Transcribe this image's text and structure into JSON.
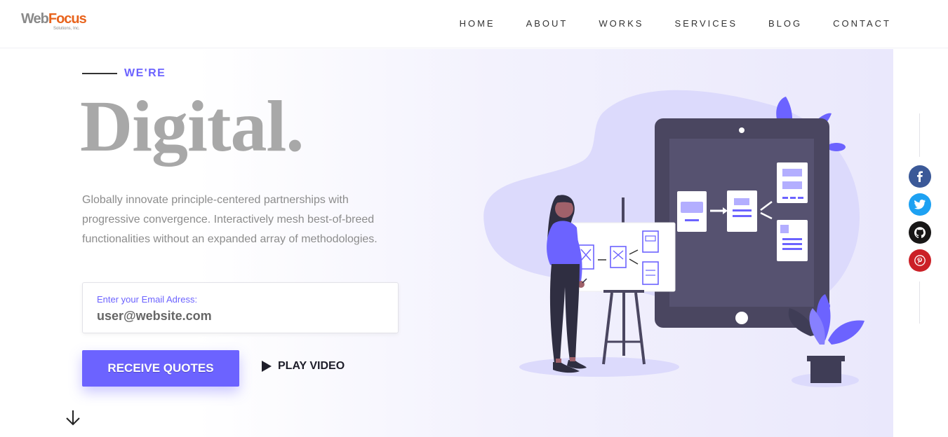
{
  "header": {
    "logo": {
      "part1": "Web",
      "part2": "Focus",
      "sub": "Solutions, Inc."
    },
    "nav": [
      "HOME",
      "ABOUT",
      "WORKS",
      "SERVICES",
      "BLOG",
      "CONTACT"
    ]
  },
  "hero": {
    "kicker": "WE'RE",
    "headline": "Digital.",
    "paragraph": "Globally innovate principle-centered partnerships with progressive convergence. Interactively mesh best-of-breed functionalities without an expanded array of methodologies.",
    "email": {
      "label": "Enter your Email Adress:",
      "value": "user@website.com"
    },
    "primary_button": "RECEIVE QUOTES",
    "secondary_button": "PLAY VIDEO"
  },
  "social": {
    "icons": [
      "facebook-icon",
      "twitter-icon",
      "github-icon",
      "pinterest-icon"
    ],
    "colors": {
      "facebook": "#3b5998",
      "twitter": "#1da1f2",
      "github": "#181717",
      "pinterest": "#cb2027"
    }
  },
  "theme": {
    "accent": "#6c63ff",
    "headline_color": "#a8a8a8",
    "text_color": "#8c8c8c"
  }
}
